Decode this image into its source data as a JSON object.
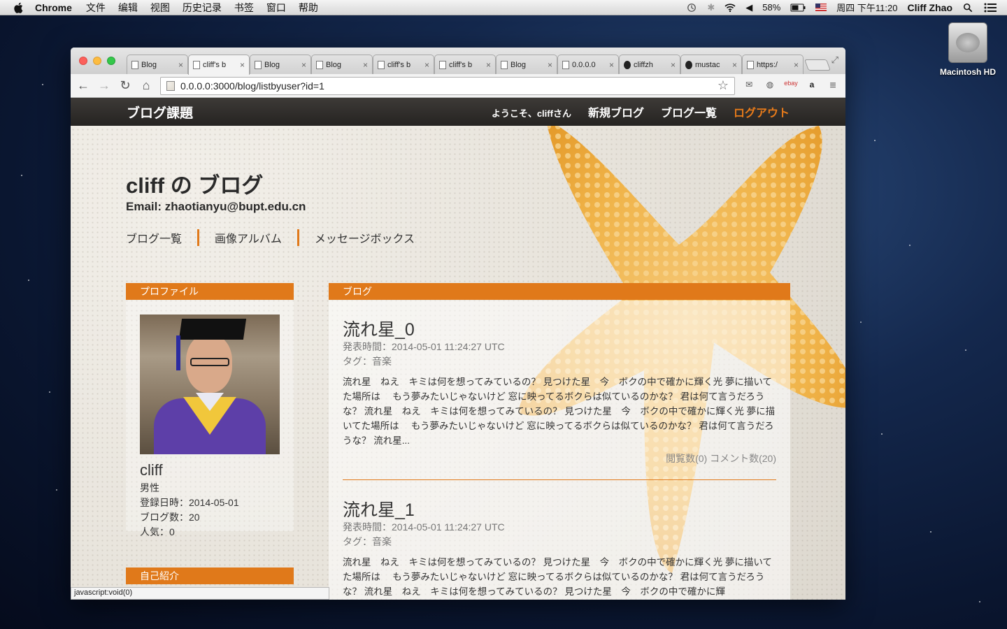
{
  "menubar": {
    "app": "Chrome",
    "items": [
      "文件",
      "编辑",
      "视图",
      "历史记录",
      "书签",
      "窗口",
      "帮助"
    ],
    "battery": "58%",
    "clock": "周四 下午11:20",
    "user": "Cliff Zhao"
  },
  "desktop": {
    "drive_label": "Macintosh HD"
  },
  "browser": {
    "tabs": [
      {
        "title": "Blog",
        "active": false,
        "icon": "page-icon"
      },
      {
        "title": "cliff's b",
        "active": true,
        "icon": "page-icon"
      },
      {
        "title": "Blog",
        "active": false,
        "icon": "page-icon"
      },
      {
        "title": "Blog",
        "active": false,
        "icon": "page-icon"
      },
      {
        "title": "cliff's b",
        "active": false,
        "icon": "page-icon"
      },
      {
        "title": "cliff's b",
        "active": false,
        "icon": "page-icon"
      },
      {
        "title": "Blog",
        "active": false,
        "icon": "page-icon"
      },
      {
        "title": "0.0.0.0",
        "active": false,
        "icon": "page-icon"
      },
      {
        "title": "cliffzh",
        "active": false,
        "icon": "github-icon"
      },
      {
        "title": "mustac",
        "active": false,
        "icon": "github-icon"
      },
      {
        "title": "https:/",
        "active": false,
        "icon": "page-icon"
      }
    ],
    "url": "0.0.0.0:3000/blog/listbyuser?id=1",
    "status_text": "javascript:void(0)"
  },
  "site": {
    "brand": "ブログ課題",
    "welcome": "ようこそ、cliffさん",
    "nav_new": "新規ブログ",
    "nav_list": "ブログ一覧",
    "nav_logout": "ログアウト",
    "accent": "#e0791a"
  },
  "blog": {
    "title": "cliff の ブログ",
    "email": "Email: zhaotianyu@bupt.edu.cn",
    "subnav": [
      "ブログ一覧",
      "画像アルバム",
      "メッセージボックス"
    ]
  },
  "profile": {
    "header": "プロファイル",
    "name": "cliff",
    "gender": "男性",
    "registered": "登録日時：2014-05-01",
    "post_count": "ブログ数：20",
    "popularity": "人気：0",
    "intro_header": "自己紹介"
  },
  "posts_header": "ブログ",
  "posts": [
    {
      "title": "流れ星_0",
      "date": "発表時間：2014-05-01 11:24:27 UTC",
      "tag": "タグ：音楽",
      "body": "流れ星　ねえ　キミは何を想ってみているの？ 見つけた星　今　ボクの中で確かに輝く光 夢に描いてた場所は　 もう夢みたいじゃないけど 窓に映ってるボクらは似ているのかな？ 君は何て言うだろうな？ 流れ星　ねえ　キミは何を想ってみているの？ 見つけた星　今　ボクの中で確かに輝く光 夢に描いてた場所は　 もう夢みたいじゃないけど 窓に映ってるボクらは似ているのかな？ 君は何て言うだろうな？ 流れ星...",
      "stats": "閲覧数(0) コメント数(20)"
    },
    {
      "title": "流れ星_1",
      "date": "発表時間：2014-05-01 11:24:27 UTC",
      "tag": "タグ：音楽",
      "body": "流れ星　ねえ　キミは何を想ってみているの？ 見つけた星　今　ボクの中で確かに輝く光 夢に描いてた場所は　 もう夢みたいじゃないけど 窓に映ってるボクらは似ているのかな？ 君は何て言うだろうな？ 流れ星　ねえ　キミは何を想ってみているの？ 見つけた星　今　ボクの中で確かに輝",
      "stats": ""
    }
  ]
}
